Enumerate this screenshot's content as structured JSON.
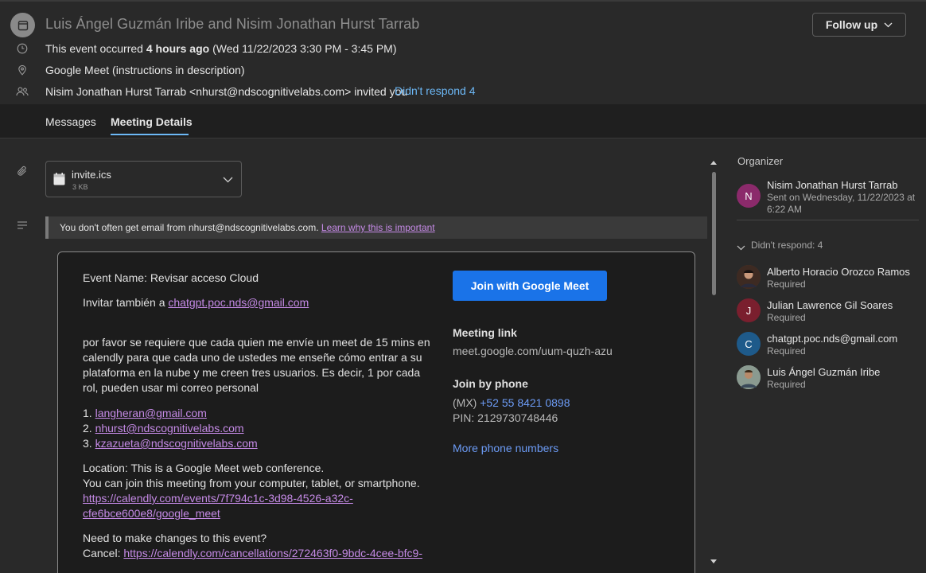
{
  "header": {
    "title": "Luis Ángel Guzmán Iribe and Nisim Jonathan Hurst Tarrab",
    "follow_up_label": "Follow up",
    "occurred_prefix": "This event occurred ",
    "occurred_bold": "4 hours ago",
    "occurred_suffix": " (Wed 11/22/2023 3:30 PM - 3:45 PM)",
    "location": "Google Meet (instructions in description)",
    "invited_by": "Nisim Jonathan Hurst Tarrab <nhurst@ndscognitivelabs.com> invited you",
    "didnt_respond": "Didn't respond 4"
  },
  "tabs": [
    {
      "label": "Messages",
      "active": false
    },
    {
      "label": "Meeting Details",
      "active": true
    }
  ],
  "attachment": {
    "name": "invite.ics",
    "size": "3 KB"
  },
  "warning": {
    "text": "You don't often get email from nhurst@ndscognitivelabs.com.",
    "link": "Learn why this is important"
  },
  "event": {
    "name_line": "Event Name: Revisar acceso Cloud",
    "invite_prefix": "Invitar también a ",
    "invite_email": "chatgpt.poc.nds@gmail.com",
    "body_lines": [
      "por favor se requiere que cada quien me envíe un meet de 15 mins en",
      "calendly para que cada uno de ustedes me enseñe cómo entrar a su",
      "plataforma en la nube y me creen tres usuarios. Es decir, 1 por cada",
      "rol, pueden usar mi correo personal"
    ],
    "list": [
      {
        "num": "1. ",
        "email": "langheran@gmail.com"
      },
      {
        "num": "2. ",
        "email": "nhurst@ndscognitivelabs.com"
      },
      {
        "num": "3. ",
        "email": "kzazueta@ndscognitivelabs.com"
      }
    ],
    "location_line": "Location: This is a Google Meet web conference.",
    "join_line": "You can join this meeting from your computer, tablet, or smartphone.",
    "calendly_link_1": "https://calendly.com/events/7f794c1c-3d98-4526-a32c-",
    "calendly_link_2": "cfe6bce600e8/google_meet",
    "changes_line": "Need to make changes to this event?",
    "cancel_prefix": "Cancel: ",
    "cancel_link": "https://calendly.com/cancellations/272463f0-9bdc-4cee-bfc9-"
  },
  "meet": {
    "join_button": "Join with Google Meet",
    "meeting_link_label": "Meeting link",
    "meeting_link": "meet.google.com/uum-quzh-azu",
    "join_phone_label": "Join by phone",
    "phone_prefix": "(MX) ",
    "phone": "+52 55 8421 0898",
    "pin": "PIN: 2129730748446",
    "more_numbers": "More phone numbers"
  },
  "organizer": {
    "heading": "Organizer",
    "initial": "N",
    "name": "Nisim Jonathan Hurst Tarrab",
    "sent_line1": "Sent on Wednesday, 11/22/2023 at",
    "sent_line2": "6:22 AM"
  },
  "attendees": {
    "heading": "Didn't respond: 4",
    "people": [
      {
        "name": "Alberto Horacio Orozco Ramos",
        "role": "Required",
        "initial": "",
        "color": "#5a3a2a"
      },
      {
        "name": "Julian Lawrence Gil Soares",
        "role": "Required",
        "initial": "J",
        "color": "#7a1f2e"
      },
      {
        "name": "chatgpt.poc.nds@gmail.com",
        "role": "Required",
        "initial": "C",
        "color": "#1e5a8a"
      },
      {
        "name": "Luis Ángel Guzmán Iribe",
        "role": "Required",
        "initial": "",
        "color": "#6a7a7a"
      }
    ]
  },
  "colors": {
    "accent": "#6cb8f6",
    "link": "#c58ae6",
    "meet_button": "#1a73e8",
    "organizer_avatar": "#8b2a6b"
  }
}
